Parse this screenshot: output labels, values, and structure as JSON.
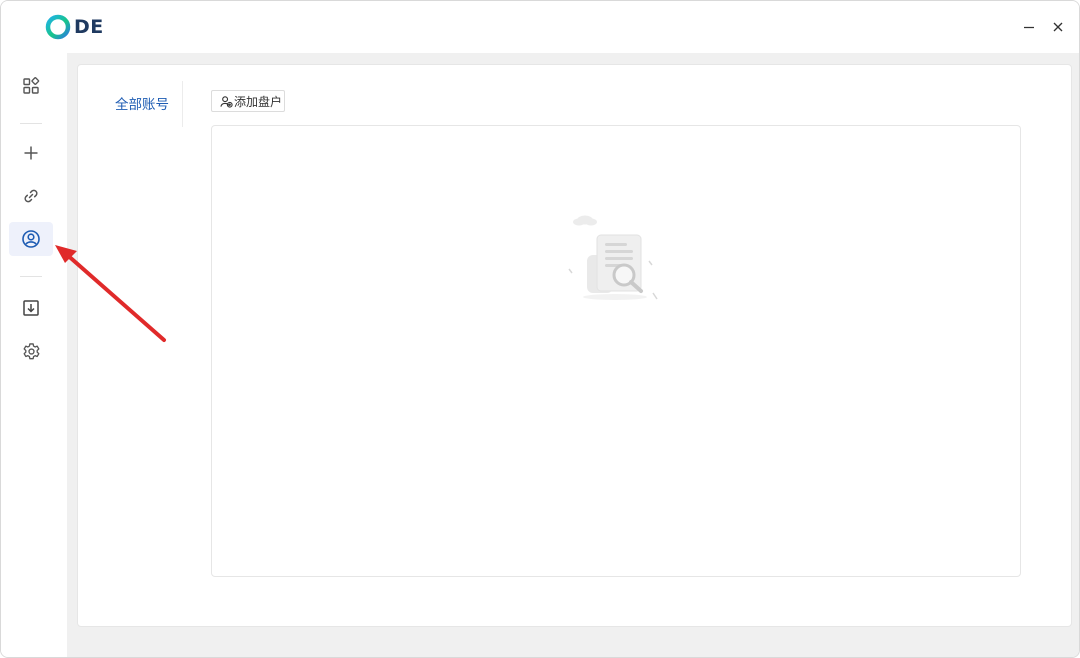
{
  "app": {
    "logo_text": "DE",
    "accent_color": "#1e5cb3"
  },
  "window_controls": {
    "minimize_icon": "minimize-icon",
    "close_icon": "close-icon"
  },
  "sidebar": {
    "items": [
      {
        "icon": "grid-icon",
        "active": false
      },
      {
        "icon": "plus-icon",
        "active": false
      },
      {
        "icon": "link-icon",
        "active": false
      },
      {
        "icon": "user-circle-icon",
        "active": true
      },
      {
        "icon": "download-icon",
        "active": false
      },
      {
        "icon": "gear-icon",
        "active": false
      }
    ]
  },
  "main": {
    "tab_all_accounts": "全部账号",
    "add_drive_button": "添加盘户",
    "empty_state_icon": "empty-search-illustration"
  },
  "annotation": {
    "arrow_color": "#e02a2a"
  }
}
